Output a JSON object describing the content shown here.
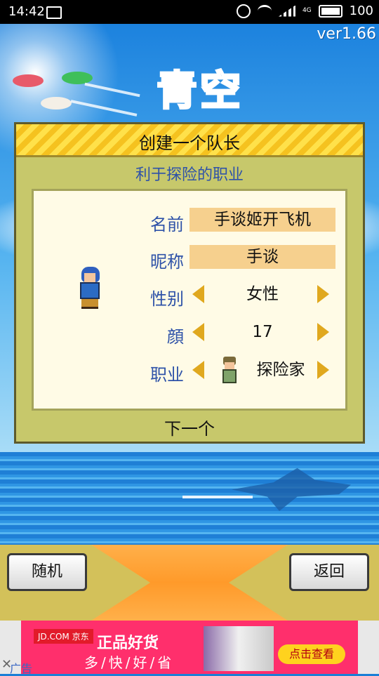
{
  "status_bar": {
    "time": "14:42",
    "network": "4G",
    "battery": "100"
  },
  "game": {
    "version": "ver1.66",
    "logo_text": "青空"
  },
  "dialog": {
    "title": "创建一个队长",
    "subtitle": "利于探险的职业",
    "fields": {
      "name_label": "名前",
      "name_value": "手谈姬开飞机",
      "nickname_label": "昵称",
      "nickname_value": "手谈",
      "gender_label": "性别",
      "gender_value": "女性",
      "face_label": "顔",
      "face_value": "17",
      "job_label": "职业",
      "job_value": "探险家"
    },
    "next_label": "下一个"
  },
  "buttons": {
    "random": "随机",
    "back": "返回"
  },
  "ad": {
    "brand": "JD.COM 京东",
    "title": "正品好货",
    "slogan": "多/快/好/省",
    "cta": "点击查看",
    "close": "✕",
    "label": "广告"
  },
  "colors": {
    "header_yellow": "#ffe14a",
    "dialog_bg": "#c7c86b",
    "label_blue": "#2e52a8",
    "value_bg": "#f6d08e",
    "arrow": "#e0a81e"
  }
}
